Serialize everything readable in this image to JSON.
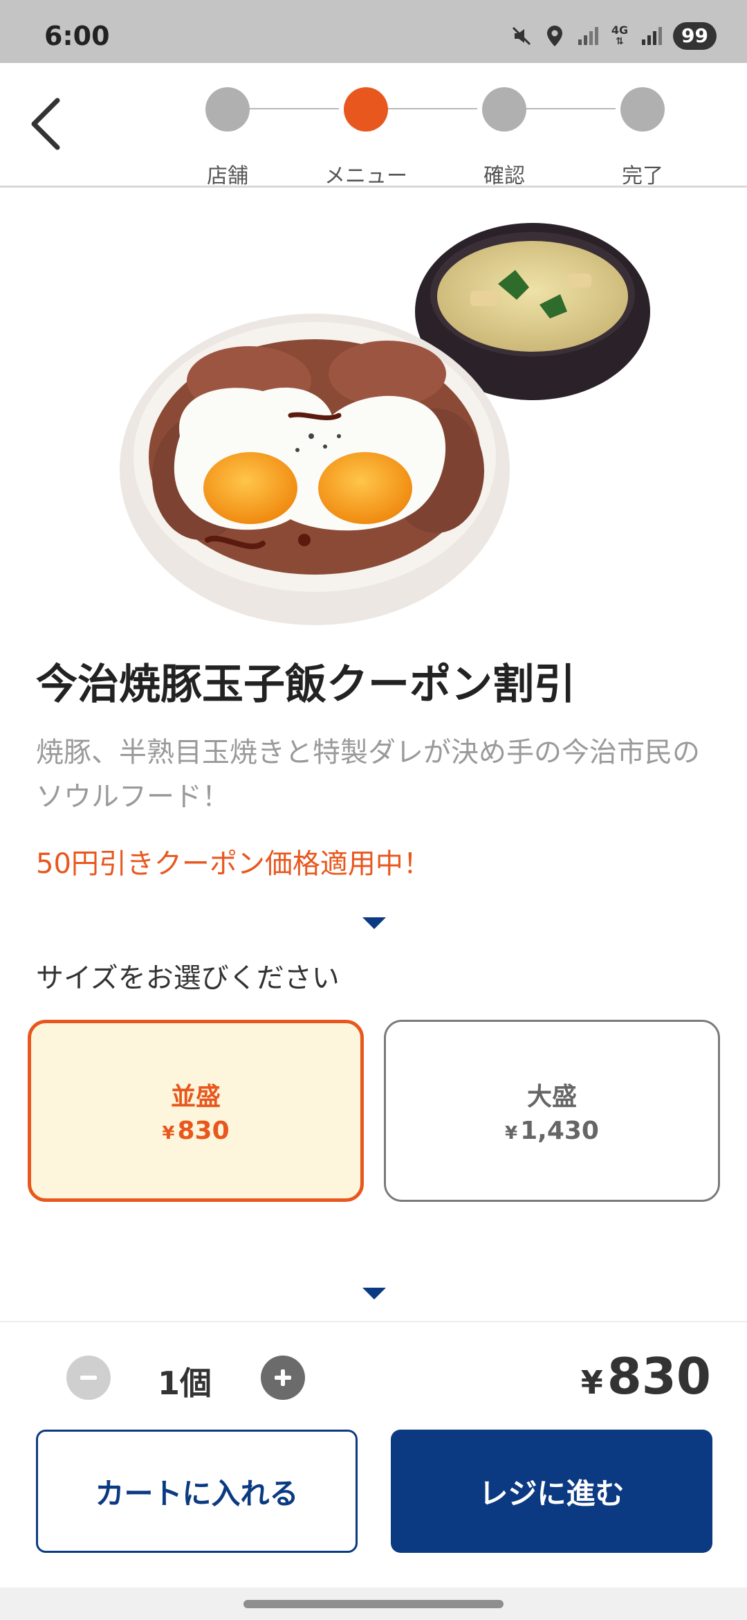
{
  "status_bar": {
    "time": "6:00",
    "battery": "99",
    "network": "4G"
  },
  "stepper": {
    "steps": [
      {
        "label": "店舗",
        "active": false
      },
      {
        "label": "メニュー",
        "active": true
      },
      {
        "label": "確認",
        "active": false
      },
      {
        "label": "完了",
        "active": false
      }
    ]
  },
  "product": {
    "title": "今治焼豚玉子飯クーポン割引",
    "description": "焼豚、半熟目玉焼きと特製ダレが決め手の今治市民のソウルフード！",
    "coupon_note": "50円引きクーポン価格適用中！"
  },
  "size_section": {
    "prompt": "サイズをお選びください",
    "options": [
      {
        "name": "並盛",
        "currency": "¥",
        "price": "830",
        "selected": true
      },
      {
        "name": "大盛",
        "currency": "¥",
        "price": "1,430",
        "selected": false
      }
    ]
  },
  "order": {
    "quantity": "1個",
    "currency": "¥",
    "total": "830",
    "add_to_cart_label": "カートに入れる",
    "checkout_label": "レジに進む"
  },
  "colors": {
    "accent": "#e8571d",
    "primary": "#0b3a82",
    "selected_bg": "#fdf6dc"
  }
}
